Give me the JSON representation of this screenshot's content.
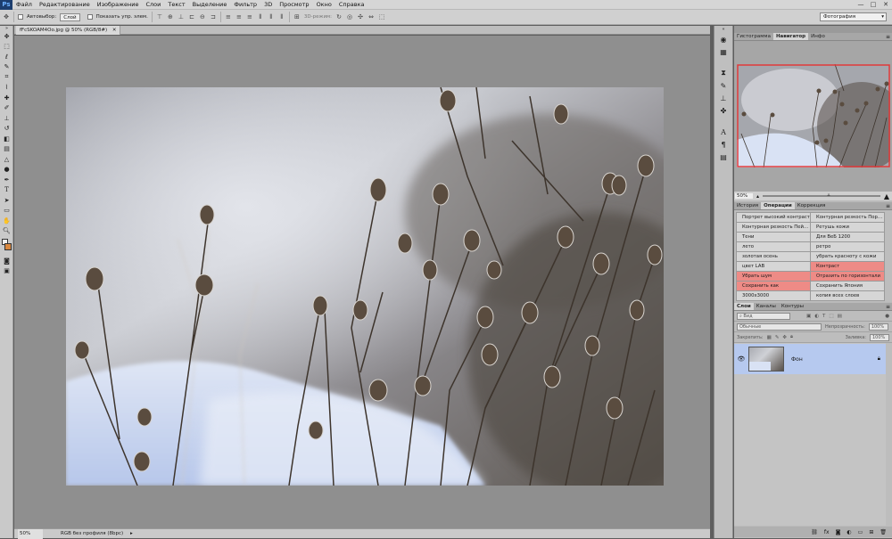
{
  "app": {
    "logo": "Ps"
  },
  "menu": [
    "Файл",
    "Редактирование",
    "Изображение",
    "Слои",
    "Текст",
    "Выделение",
    "Фильтр",
    "3D",
    "Просмотр",
    "Окно",
    "Справка"
  ],
  "window_controls": [
    "—",
    "□",
    "✕"
  ],
  "options": {
    "autoselect_label": "Автовыбор:",
    "autoselect_value": "Слой",
    "show_controls_label": "Показать упр. элем.",
    "mode_3d_label": "3D-режим:",
    "workspace": "Фотография"
  },
  "document": {
    "tab_title": "fFcSKOAM4Oo.jpg @ 50% (RGB/8#)",
    "status_zoom": "50%",
    "status_profile": "RGB без профиля (8bpc)"
  },
  "panels": {
    "top_tabs": [
      "Гистограмма",
      "Навигатор",
      "Инфо"
    ],
    "top_active": 1,
    "navigator_zoom": "50%",
    "actions_tabs": [
      "История",
      "Операции",
      "Коррекция"
    ],
    "actions_active": 1,
    "actions": [
      {
        "left": "Портрет высокий контраст",
        "right": "Контурная резкость Пор…",
        "left_red": false,
        "right_red": false
      },
      {
        "left": "Контурная резкость Пей…",
        "right": "Ретушь кожи",
        "left_red": false,
        "right_red": false
      },
      {
        "left": "Тени",
        "right": "Для ВеБ 1200",
        "left_red": false,
        "right_red": false
      },
      {
        "left": "лето",
        "right": "ретро",
        "left_red": false,
        "right_red": false
      },
      {
        "left": "золотая осень",
        "right": "убрать красноту с кожи",
        "left_red": false,
        "right_red": false
      },
      {
        "left": "цвет LAB",
        "right": "Контраст",
        "left_red": false,
        "right_red": true
      },
      {
        "left": "Убрать шум",
        "right": "Отразить по горизонтали",
        "left_red": true,
        "right_red": true
      },
      {
        "left": "Сохранить как",
        "right": "Сохранить Япония",
        "left_red": true,
        "right_red": false
      },
      {
        "left": "3000x3000",
        "right": "копия всех слоев",
        "left_red": false,
        "right_red": false
      }
    ],
    "layers_tabs": [
      "Слои",
      "Каналы",
      "Контуры"
    ],
    "layers_active": 0,
    "layer_filter": "Вид",
    "blend_mode": "Обычные",
    "opacity_label": "Непрозрачность:",
    "opacity_value": "100%",
    "lock_label": "Закрепить:",
    "fill_label": "Заливка:",
    "fill_value": "100%",
    "layer_name": "Фон"
  },
  "colors": {
    "accent": "#1d3e6e",
    "action_red": "#ee8b86",
    "layer_selected": "#b6c9ef",
    "nav_frame": "#e23a3a"
  }
}
